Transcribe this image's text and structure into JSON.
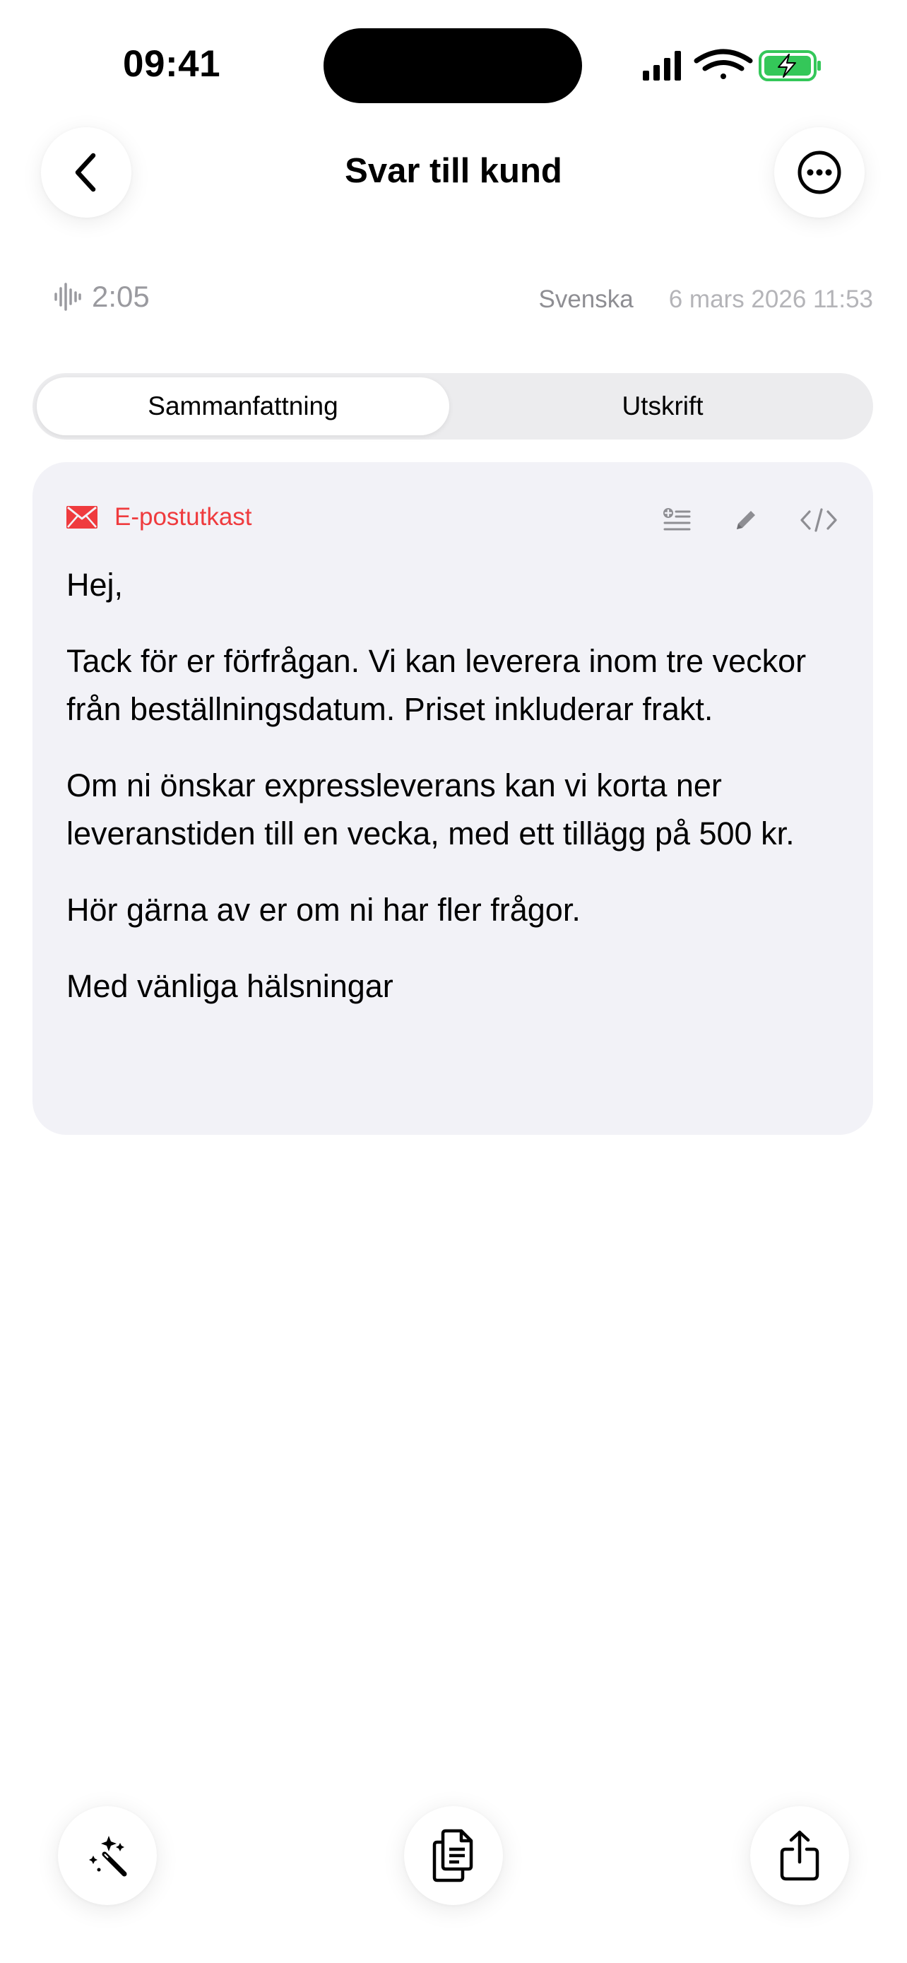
{
  "status_bar": {
    "time": "09:41"
  },
  "header": {
    "title": "Svar till kund",
    "back_icon": "chevron-left-icon",
    "more_icon": "ellipsis-circle-icon"
  },
  "meta": {
    "duration": "2:05",
    "language": "Svenska",
    "datetime": "6 mars 2026 11:53"
  },
  "tabs": [
    {
      "label": "Sammanfattning",
      "selected": true
    },
    {
      "label": "Utskrift",
      "selected": false
    }
  ],
  "card": {
    "type_label": "E-postutkast",
    "type_icon": "envelope-icon",
    "accent_color": "#EF3B3E",
    "tools": [
      "add-list-icon",
      "pencil-icon",
      "code-icon"
    ],
    "paragraphs": [
      "Hej,",
      "Tack för er förfrågan. Vi kan leverera inom tre veckor från beställningsdatum. Priset inkluderar frakt.",
      "Om ni önskar expressleverans kan vi korta ner leveranstiden till en vecka, med ett tillägg på 500 kr.",
      "Hör gärna av er om ni har fler frågor.",
      "Med vänliga hälsningar"
    ]
  },
  "bottom_bar": {
    "buttons": [
      "magic-wand-icon",
      "copy-icon",
      "share-icon"
    ]
  }
}
